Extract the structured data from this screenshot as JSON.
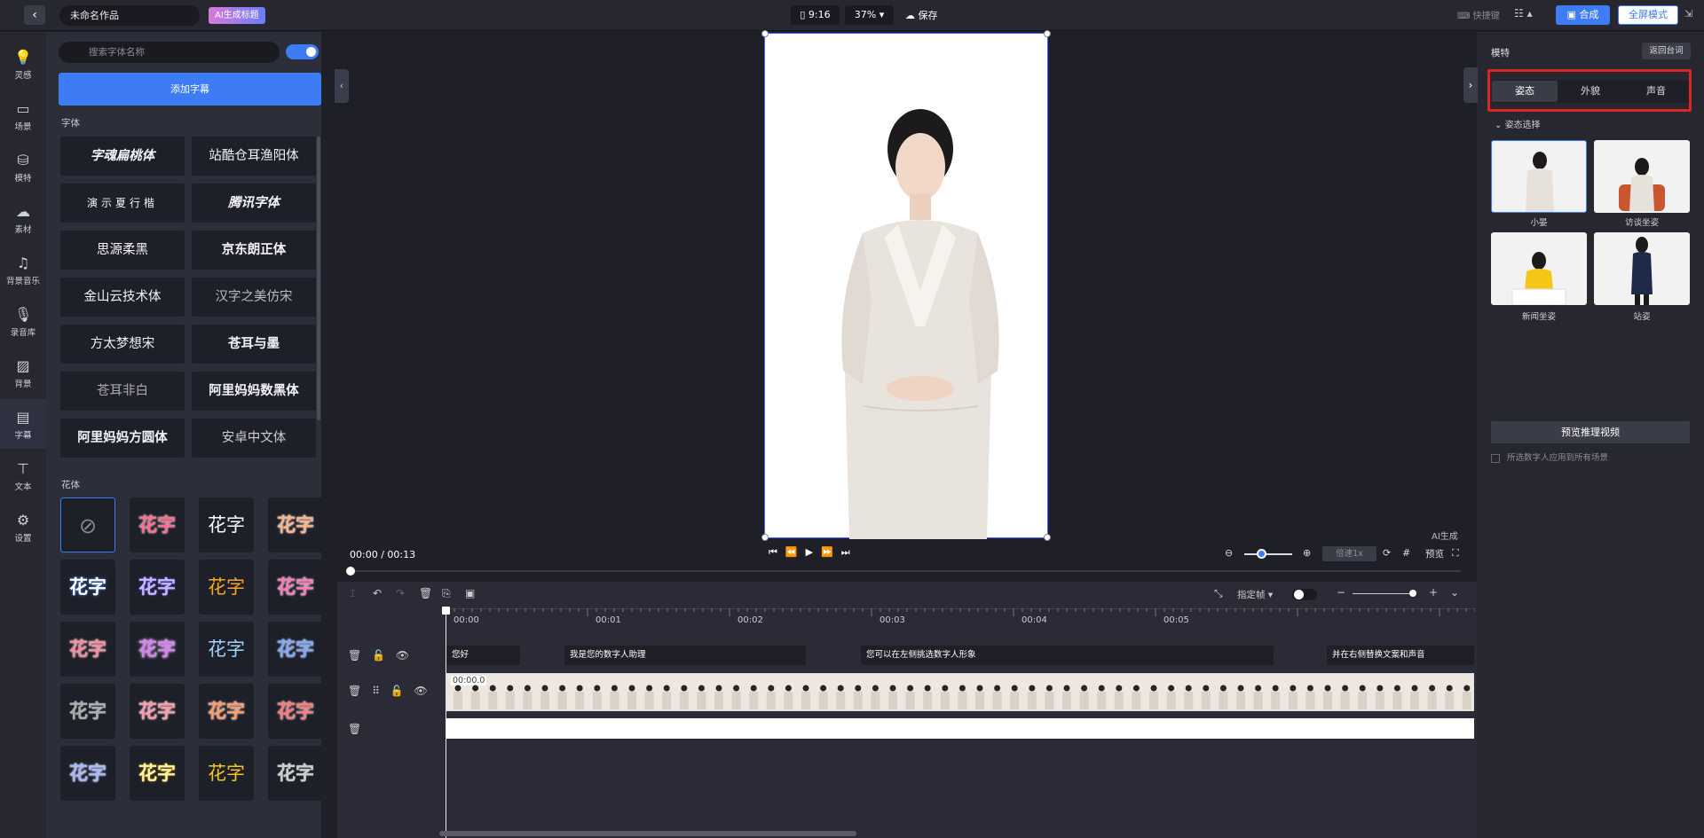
{
  "topbar": {
    "back_icon": "chevron-left-icon",
    "title": "未命名作品",
    "ai_title_btn": "AI生成标题",
    "ratio": "9:16",
    "zoom": "37%",
    "save": "保存",
    "shortcut": "快捷键",
    "compose": "合成",
    "fullscreen": "全屏模式"
  },
  "nav": {
    "items": [
      {
        "label": "灵感",
        "icon": "bulb-icon"
      },
      {
        "label": "场景",
        "icon": "scene-icon"
      },
      {
        "label": "模特",
        "icon": "model-icon"
      },
      {
        "label": "素材",
        "icon": "cloud-icon"
      },
      {
        "label": "背景音乐",
        "icon": "music-icon"
      },
      {
        "label": "录音库",
        "icon": "mic-icon"
      },
      {
        "label": "背景",
        "icon": "stripes-icon"
      },
      {
        "label": "字幕",
        "icon": "document-icon"
      },
      {
        "label": "文本",
        "icon": "text-icon"
      },
      {
        "label": "设置",
        "icon": "gear-icon"
      }
    ],
    "active": "字幕"
  },
  "font_panel": {
    "search_placeholder": "搜索字体名称",
    "add_subtitle": "添加字幕",
    "fonts_title": "字体",
    "fonts": [
      "字魂扁桃体",
      "站酷仓耳渔阳体",
      "演示夏行楷",
      "腾讯字体",
      "思源柔黑",
      "京东朗正体",
      "金山云技术体",
      "汉字之美仿宋",
      "方太梦想宋",
      "苍耳与墨",
      "苍耳非白",
      "阿里妈妈数黑体",
      "阿里妈妈方圆体",
      "安卓中文体"
    ],
    "flower_title": "花体",
    "flower_text": "花字"
  },
  "stage": {
    "ai_generated": "AI生成",
    "time": "00:00 / 00:13",
    "speed": "倍速1x",
    "preview": "预览"
  },
  "timeline": {
    "frame_select": "指定帧",
    "ticks": [
      "00:00",
      "00:01",
      "00:02",
      "00:03",
      "00:04",
      "00:05"
    ],
    "subtitles": [
      "您好",
      "我是您的数字人助理",
      "您可以在左侧挑选数字人形象",
      "并在右侧替换文案和声音"
    ],
    "video_start": "00:00.0"
  },
  "right_panel": {
    "title": "模特",
    "back_script": "返回台词",
    "tabs": [
      "姿态",
      "外貌",
      "声音"
    ],
    "active_tab": "姿态",
    "pose_section": "姿态选择",
    "poses": [
      "小晏",
      "访谈坐姿",
      "新闻坐姿",
      "站姿"
    ],
    "preview_btn": "预览推理视频",
    "apply_all": "所选数字人应用到所有场景"
  },
  "colors": {
    "accent": "#3d7cf5",
    "highlight_box": "#e02424",
    "panel_bg": "#2c2e3a"
  }
}
